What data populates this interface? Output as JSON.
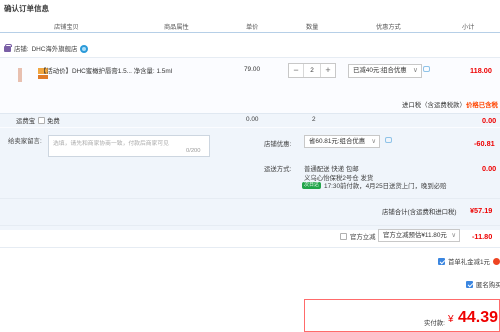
{
  "page": {
    "title": "确认订单信息"
  },
  "table_header": [
    "店铺宝贝",
    "商品属性",
    "单价",
    "数量",
    "优惠方式",
    "小计"
  ],
  "shop": {
    "label": "店铺:",
    "name": "DHC海外旗舰店"
  },
  "item": {
    "name": "【活动价】DHC蜜橄护唇膏1.5... 净含量: 1.5ml",
    "unit_price": "79.00",
    "quantity": "2",
    "promo": "已减40元:组合优惠",
    "subtotal": "118.00",
    "tax_label": "进口税（含运费税款）",
    "tax_note": "价格已含税"
  },
  "insurance": {
    "label": "运费宝",
    "option": "免费",
    "price": "0.00",
    "qty": "2",
    "subtotal": "0.00"
  },
  "message": {
    "label": "给卖家留言:",
    "placeholder": "选填，请先和商家协商一致，付款后商家可见",
    "count": "0/200"
  },
  "shop_discount": {
    "label": "店铺优惠:",
    "value": "省60.81元:组合优惠",
    "amount": "-60.81"
  },
  "delivery": {
    "label": "运送方式:",
    "method": "普通配送 快递 包邮",
    "warehouse": "义乌心怡保税2号仓  发货",
    "badge": "次日达",
    "eta": "17:30前付款，4月25日送货上门，晚到必赔",
    "price": "0.00"
  },
  "shop_total": {
    "label": "店铺合计(含运费和进口税)",
    "amount": "¥57.19"
  },
  "official_discount": {
    "label": "官方立减",
    "value": "官方立减预估¥11.80元",
    "amount": "-11.80"
  },
  "gift_card": {
    "label": "首单礼金减1元"
  },
  "anonymous": {
    "label": "匿名购买"
  },
  "final": {
    "label": "实付款:",
    "currency": "¥",
    "amount": "44.39"
  },
  "colors": {
    "accent": "#ee0000",
    "link": "#3b86e0",
    "header_line": "#b6cfe7",
    "panel": "#f0f5fb"
  }
}
